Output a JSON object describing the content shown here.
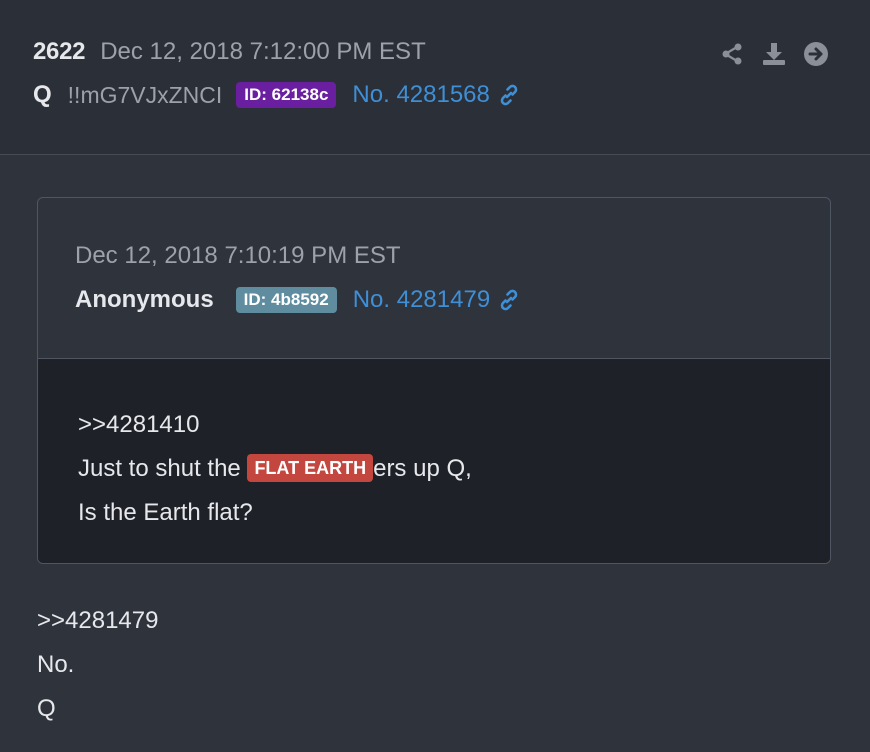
{
  "post": {
    "number": "2622",
    "date": "Dec 12, 2018 7:12:00 PM EST",
    "author": "Q",
    "tripcode": "!!mG7VJxZNCI",
    "id_badge": "ID: 62138c",
    "post_no": "No. 4281568",
    "actions": [
      "share-icon",
      "download-icon",
      "arrow-circle-right-icon"
    ]
  },
  "quoted": {
    "date": "Dec 12, 2018 7:10:19 PM EST",
    "author": "Anonymous",
    "id_badge": "ID: 4b8592",
    "post_no": "No. 4281479",
    "line1": ">>4281410",
    "line2_pre": "Just to shut the ",
    "line2_flag": "FLAT EARTH",
    "line2_post": "ers up Q,",
    "line3": "Is the Earth flat?"
  },
  "reply": {
    "line1": ">>4281479",
    "line2": "No.",
    "line3": "Q"
  },
  "colors": {
    "background": "#2f333c",
    "link": "#3f8fd6",
    "badge_purple": "#6a1fa0",
    "badge_teal": "#5f8d9f",
    "flag_red": "#c4473f"
  }
}
